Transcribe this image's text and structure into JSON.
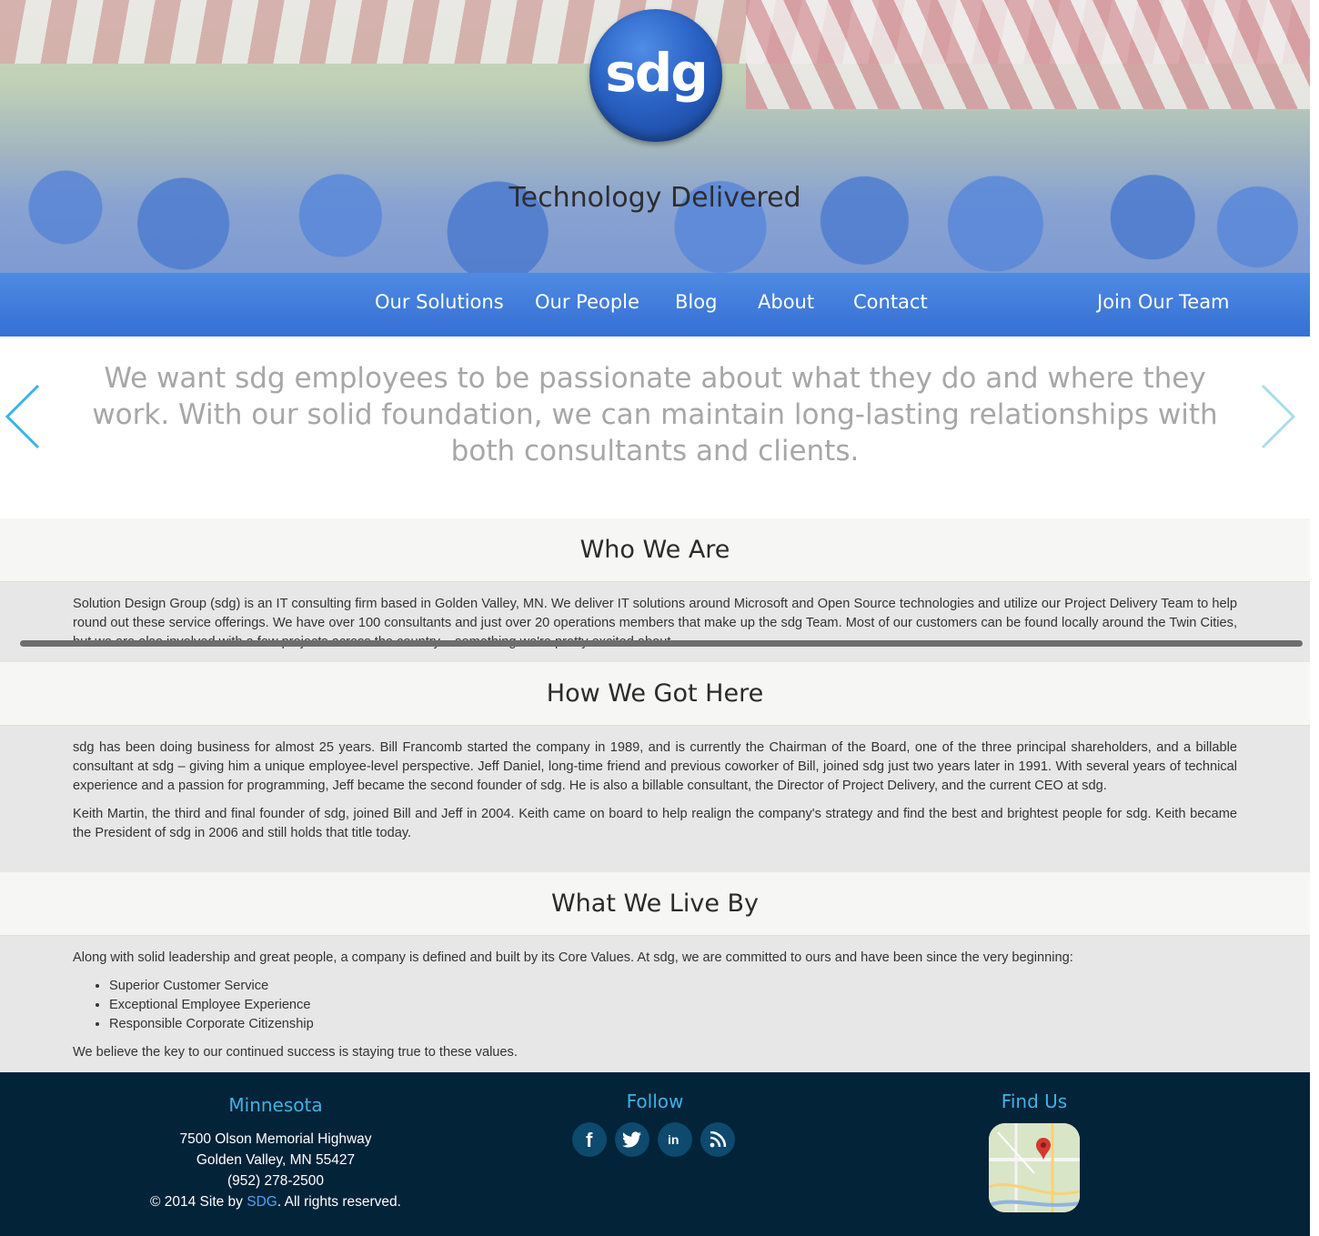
{
  "hero": {
    "logo_text": "sdg",
    "tagline": "Technology Delivered"
  },
  "nav": {
    "items": [
      "Our Solutions",
      "Our People",
      "Blog",
      "About",
      "Contact"
    ],
    "join": "Join Our Team"
  },
  "quote": "We want sdg employees to be passionate about what they do and where they work. With our solid foundation, we can maintain long-lasting relationships with both consultants and clients.",
  "sections": {
    "who": {
      "title": "Who We Are",
      "text": "Solution Design Group (sdg) is an IT consulting firm based in Golden Valley, MN. We deliver IT solutions around Microsoft and Open Source technologies and utilize our Project Delivery Team to help round out these service offerings. We have over 100 consultants and just over 20 operations members that make up the sdg Team. Most of our customers can be found locally around the Twin Cities, but we are also involved with a few projects across the country – something we're pretty excited about."
    },
    "how": {
      "title": "How We Got Here",
      "p1": "sdg has been doing business for almost 25 years. Bill Francomb started the company in 1989, and is currently the Chairman of the Board, one of the three principal shareholders, and a billable consultant at sdg – giving him a unique employee-level perspective. Jeff Daniel, long-time friend and previous coworker of Bill, joined sdg just two years later in 1991. With several years of technical experience and a passion for programming, Jeff became the second founder of sdg. He is also a billable consultant, the Director of Project Delivery, and the current CEO at sdg.",
      "p2": "Keith Martin, the third and final founder of sdg, joined Bill and Jeff in 2004. Keith came on board to help realign the company's strategy and find the best and brightest people for sdg. Keith became the President of sdg in 2006 and still holds that title today."
    },
    "live": {
      "title": "What We Live By",
      "intro": "Along with solid leadership and great people, a company is defined and built by its Core Values. At sdg, we are committed to ours and have been since the very beginning:",
      "values": [
        "Superior Customer Service",
        "Exceptional Employee Experience",
        "Responsible Corporate Citizenship"
      ],
      "outro": "We believe the key to our continued success is staying true to these values."
    }
  },
  "footer": {
    "location_title": "Minnesota",
    "address1": "7500 Olson Memorial Highway",
    "address2": "Golden Valley, MN 55427",
    "phone": "(952) 278-2500",
    "copyright_pre": "© 2014 Site by ",
    "copyright_link": "SDG",
    "copyright_post": ". All rights reserved.",
    "follow_title": "Follow",
    "find_title": "Find Us"
  },
  "colors": {
    "nav": "#3f7ddb",
    "footer": "#032339",
    "accent": "#3fb2e6",
    "arrow": "#3bb4e5"
  }
}
